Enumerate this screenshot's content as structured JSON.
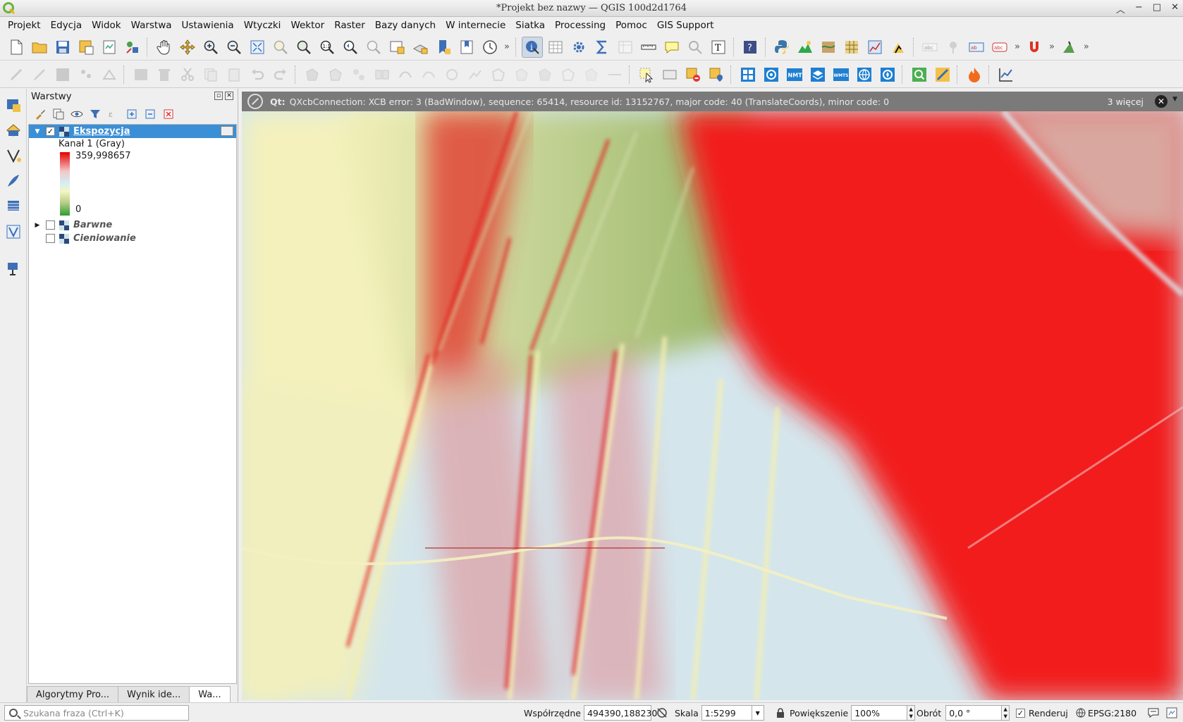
{
  "window": {
    "title": "*Projekt bez nazwy — QGIS 100d2d1764"
  },
  "menu": [
    "Projekt",
    "Edycja",
    "Widok",
    "Warstwa",
    "Ustawienia",
    "Wtyczki",
    "Wektor",
    "Raster",
    "Bazy danych",
    "W internecie",
    "Siatka",
    "Processing",
    "Pomoc",
    "GIS Support"
  ],
  "toolbar2_labels": {
    "nmt": "NMT",
    "wmts": "WMTS"
  },
  "layers_panel": {
    "title": "Warstwy",
    "layers": [
      {
        "name": "Ekspozycja",
        "checked": true,
        "selected": true,
        "expanded": true
      },
      {
        "name": "Barwne",
        "checked": false,
        "selected": false,
        "expanded": false
      },
      {
        "name": "Cieniowanie",
        "checked": false,
        "selected": false,
        "expanded": false
      }
    ],
    "legend": {
      "band": "Kanał 1 (Gray)",
      "max": "359,998657",
      "min": "0"
    }
  },
  "bottom_tabs": [
    "Algorytmy Pro...",
    "Wynik ide...",
    "Wa..."
  ],
  "message_bar": {
    "title": "Qt:",
    "text": "QXcbConnection: XCB error: 3 (BadWindow), sequence: 65414, resource id: 13152767, major code: 40 (TranslateCoords), minor code: 0",
    "more": "3 więcej"
  },
  "statusbar": {
    "search_placeholder": "Szukana fraza (Ctrl+K)",
    "coords_label": "Współrzędne",
    "coords_value": "494390,188230",
    "scale_label": "Skala",
    "scale_value": "1:5299",
    "magnifier_label": "Powiększenie",
    "magnifier_value": "100%",
    "rotation_label": "Obrót",
    "rotation_value": "0,0 °",
    "render_label": "Renderuj",
    "crs": "EPSG:2180"
  },
  "colors": {
    "selection": "#3a8fd6",
    "aspect_red": "#ff1a1a",
    "aspect_green": "#9bb86a",
    "aspect_yellow": "#f5f3bd",
    "aspect_blue": "#cfe3ea"
  }
}
